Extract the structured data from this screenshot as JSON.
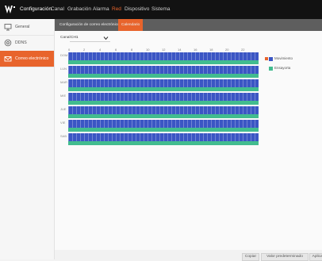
{
  "topbar": {
    "title": "Configuración",
    "nav": [
      {
        "label": "Canal",
        "active": false
      },
      {
        "label": "Grabación",
        "active": false
      },
      {
        "label": "Alarma",
        "active": false
      },
      {
        "label": "Red",
        "active": true
      },
      {
        "label": "Dispositivo",
        "active": false
      },
      {
        "label": "Sistema",
        "active": false
      }
    ]
  },
  "sidebar": {
    "items": [
      {
        "label": "General",
        "icon": "monitor-icon",
        "active": false
      },
      {
        "label": "DDNS",
        "icon": "globe-icon",
        "active": false
      },
      {
        "label": "Correo electrónico",
        "icon": "envelope-icon",
        "active": true
      }
    ]
  },
  "subtabs": [
    {
      "label": "Configuración de correo electrónico",
      "active": false
    },
    {
      "label": "Calendario",
      "active": true
    }
  ],
  "canal": {
    "label": "Canal",
    "value": "CH1"
  },
  "schedule": {
    "hour_ticks": [
      "0",
      "2",
      "4",
      "6",
      "8",
      "10",
      "12",
      "14",
      "16",
      "18",
      "20",
      "22"
    ],
    "days": [
      "DOM",
      "LUN",
      "MAR",
      "MIE",
      "JUE",
      "VIE",
      "SAB"
    ]
  },
  "legend": {
    "motion": "Movimiento",
    "alarm": "Ensayorta"
  },
  "colors": {
    "motion": "#3b56c4",
    "alarm": "#42bc8f",
    "accent": "#e8642c"
  },
  "footer": {
    "copy": "Copiar",
    "defaults": "Valor predeterminado",
    "apply": "Aplicar"
  }
}
